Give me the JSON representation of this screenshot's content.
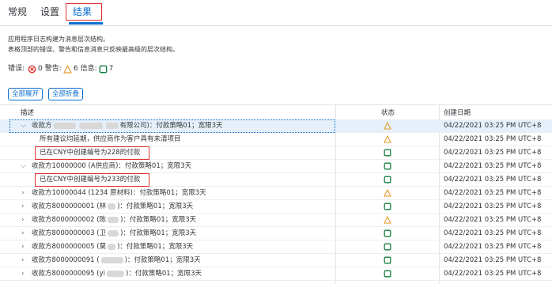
{
  "tabs": [
    {
      "label": "常规"
    },
    {
      "label": "设置"
    },
    {
      "label": "结果"
    }
  ],
  "description": [
    "应用程序日志构建为消息层次结构。",
    "表格顶部的错误、警告和信息消息只反映最高级的层次结构。"
  ],
  "counts": {
    "error_label": "错误:",
    "error_count": "0",
    "warning_label": "警告:",
    "warning_count": "6",
    "info_label": "信息:",
    "info_count": "7"
  },
  "buttons": {
    "expand_all": "全部展开",
    "collapse_all": "全部折叠"
  },
  "columns": {
    "description": "描述",
    "status": "状态",
    "created": "创建日期"
  },
  "colors": {
    "accent": "#0a6ed1",
    "warning": "#e9a23b",
    "success": "#107e3e",
    "error": "#e03030",
    "highlight": "#e03030"
  },
  "rows": [
    {
      "prefix": "收款方",
      "suffix": "有限公司)：付款策略01；宽限3天",
      "status": "warning",
      "date": "04/22/2021 03:25 PM UTC+8"
    },
    {
      "prefix": "所有建议均延期，供应商作为客户具有未清项目",
      "suffix": "",
      "status": "warning",
      "date": "04/22/2021 03:25 PM UTC+8"
    },
    {
      "prefix": "已在CNY中创建编号为228的付款",
      "suffix": "",
      "status": "success",
      "date": "04/22/2021 03:25 PM UTC+8"
    },
    {
      "prefix": "收款方10000000 (A供应商)：付款策略01；宽限3天",
      "suffix": "",
      "status": "success",
      "date": "04/22/2021 03:25 PM UTC+8"
    },
    {
      "prefix": "已在CNY中创建编号为233的付款",
      "suffix": "",
      "status": "success",
      "date": "04/22/2021 03:25 PM UTC+8"
    },
    {
      "prefix": "收款方10000044 (1234 原材料)：付款策略01；宽限3天",
      "suffix": "",
      "status": "warning",
      "date": "04/22/2021 03:25 PM UTC+8"
    },
    {
      "prefix": "收款方8000000001 (林",
      "suffix": ")：付款策略01；宽限3天",
      "status": "success",
      "date": "04/22/2021 03:25 PM UTC+8"
    },
    {
      "prefix": "收款方8000000002 (陈",
      "suffix": ")：付款策略01；宽限3天",
      "status": "warning",
      "date": "04/22/2021 03:25 PM UTC+8"
    },
    {
      "prefix": "收款方8000000003 (卫",
      "suffix": ")：付款策略01；宽限3天",
      "status": "success",
      "date": "04/22/2021 03:25 PM UTC+8"
    },
    {
      "prefix": "收款方8000000005 (莫",
      "suffix": ")：付款策略01；宽限3天",
      "status": "success",
      "date": "04/22/2021 03:25 PM UTC+8"
    },
    {
      "prefix": "收款方8000000091 (",
      "suffix": ")：付款策略01；宽限3天",
      "status": "success",
      "date": "04/22/2021 03:25 PM UTC+8"
    },
    {
      "prefix": "收款方8000000095 (yi",
      "suffix": ")：付款策略01；宽限3天",
      "status": "success",
      "date": "04/22/2021 03:25 PM UTC+8"
    }
  ]
}
